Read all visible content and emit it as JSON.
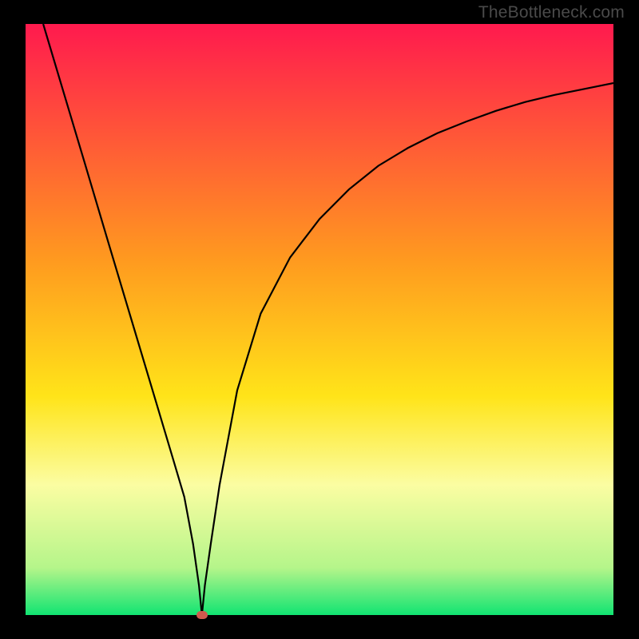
{
  "watermark": "TheBottleneck.com",
  "chart_data": {
    "type": "line",
    "title": "",
    "xlabel": "",
    "ylabel": "",
    "xlim": [
      0,
      100
    ],
    "ylim": [
      0,
      100
    ],
    "x": [
      3,
      6,
      10,
      14,
      18,
      22,
      25,
      27,
      28.5,
      29.5,
      30,
      30.5,
      31.5,
      33,
      36,
      40,
      45,
      50,
      55,
      60,
      65,
      70,
      75,
      80,
      85,
      90,
      95,
      100
    ],
    "y": [
      100,
      90,
      76.7,
      63.3,
      50,
      36.7,
      26.7,
      20,
      12,
      5,
      0,
      5,
      12,
      22,
      38,
      51,
      60.5,
      67,
      72,
      76,
      79,
      81.5,
      83.5,
      85.3,
      86.8,
      88,
      89,
      90
    ],
    "minimum": {
      "x": 30,
      "y": 0
    },
    "annotations": [],
    "background_gradient": {
      "stops": [
        {
          "offset": 0,
          "color": "#ff1a4e"
        },
        {
          "offset": 40,
          "color": "#ff9a1f"
        },
        {
          "offset": 63,
          "color": "#ffe419"
        },
        {
          "offset": 78,
          "color": "#fbfda2"
        },
        {
          "offset": 92,
          "color": "#b5f58a"
        },
        {
          "offset": 100,
          "color": "#11e472"
        }
      ]
    },
    "marker_color": "#cf5a4e"
  }
}
